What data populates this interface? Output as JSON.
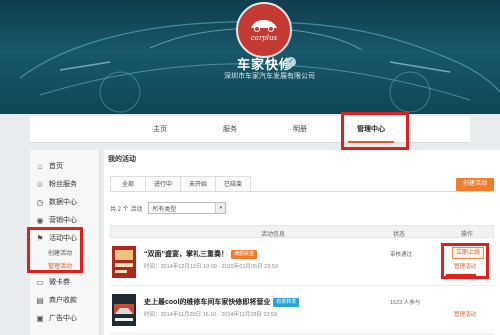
{
  "banner": {
    "logo_text": "carplus",
    "shop_name": "车家快修",
    "verify_mark": "✓",
    "company": "深圳市车家汽车发展有限公司"
  },
  "nav": {
    "items": [
      "主页",
      "服务",
      "明册",
      "管理中心"
    ],
    "active": "管理中心"
  },
  "sidebar": {
    "items": [
      {
        "icon": "home-icon",
        "label": "首页"
      },
      {
        "icon": "fans-icon",
        "label": "粉丝服务"
      },
      {
        "icon": "data-icon",
        "label": "数据中心"
      },
      {
        "icon": "marketing-icon",
        "label": "营销中心"
      },
      {
        "icon": "flag-icon",
        "label": "活动中心"
      },
      {
        "icon": "card-icon",
        "label": "微卡券"
      },
      {
        "icon": "shop-icon",
        "label": "商户收款"
      },
      {
        "icon": "ad-icon",
        "label": "广告中心"
      }
    ],
    "sub_items": [
      "创建活动",
      "管理活动"
    ]
  },
  "main": {
    "title": "我的活动",
    "tabs": [
      "全部",
      "进行中",
      "未开始",
      "已结束"
    ],
    "create_button": "创建活动",
    "count_text": "共 2 个 活动",
    "filter_value": "所有类型",
    "caret": "▾",
    "headers": {
      "info": "活动信息",
      "status": "状态",
      "op": "操作"
    },
    "rows": [
      {
        "title": "“双面”盛宴，掌礼三重奏！",
        "tag": "满额就送",
        "tag_color": "#f07c2e",
        "time": "时间：2014年12月12日 10:00 - 2015年01月05日 23:59",
        "status": "审核通过",
        "button": "立即上线",
        "link": "管理活动"
      },
      {
        "title": "史上最cool的维修车间车家快修即将营业",
        "tag": "有奖转发",
        "tag_color": "#2aa3d6",
        "time": "时间：2014年11月20日 16:10 - 2014年11月28日 23:59",
        "status": "1523 人参与",
        "link": "管理活动"
      }
    ]
  },
  "colors": {
    "accent": "#e25a2b",
    "highlight": "#e02020",
    "banner": "#17586a"
  }
}
